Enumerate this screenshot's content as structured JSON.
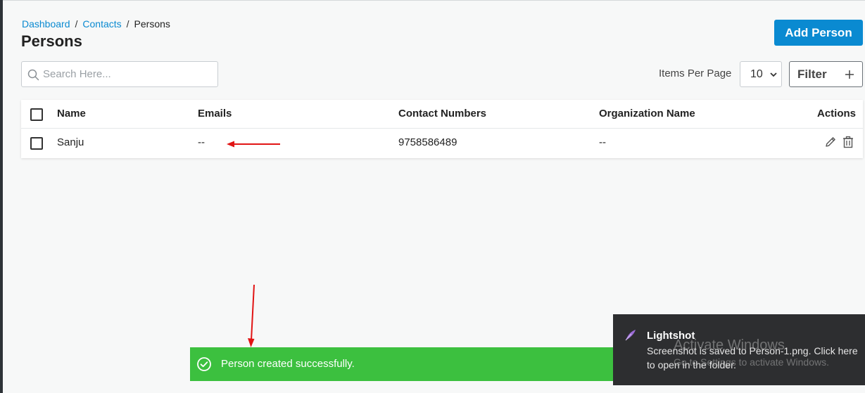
{
  "breadcrumb": {
    "dashboard": "Dashboard",
    "contacts": "Contacts",
    "current": "Persons",
    "separator": "/"
  },
  "page": {
    "title": "Persons"
  },
  "toolbar": {
    "add_label": "Add Person",
    "search_placeholder": "Search Here...",
    "items_per_page_label": "Items Per Page",
    "items_per_page_value": "10",
    "filter_label": "Filter"
  },
  "table": {
    "columns": [
      "Name",
      "Emails",
      "Contact Numbers",
      "Organization Name",
      "Actions"
    ],
    "rows": [
      {
        "name": "Sanju",
        "emails": "--",
        "contact_numbers": "9758586489",
        "organization": "--"
      }
    ]
  },
  "toast": {
    "message": "Person created successfully."
  },
  "notification": {
    "title": "Lightshot",
    "message": "Screenshot is saved to Person-1.png. Click here to open in the folder."
  },
  "watermark": {
    "line1": "Activate Windows",
    "line2": "Go to Settings to activate Windows."
  },
  "colors": {
    "accent": "#0a8ad1",
    "success": "#3cc03f",
    "annotation_arrow": "#e11414"
  }
}
